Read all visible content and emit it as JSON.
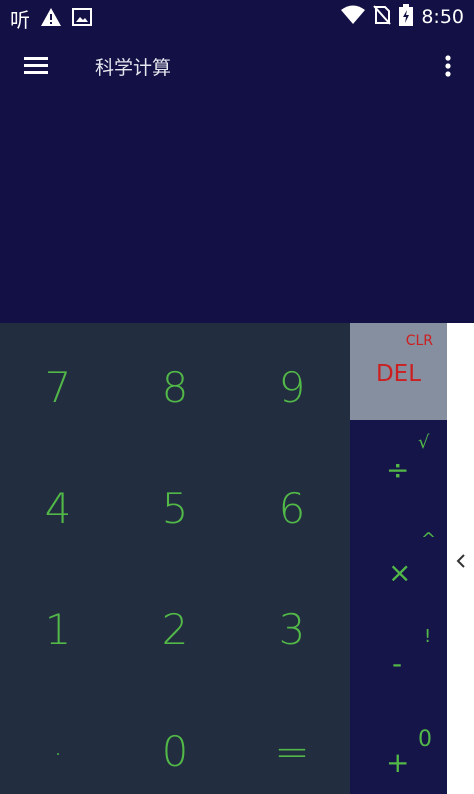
{
  "status_bar": {
    "app_glyph": "听",
    "time": "8:50",
    "icons": [
      "warning-icon",
      "image-icon",
      "wifi-icon",
      "no-sim-icon",
      "battery-charging-icon"
    ]
  },
  "app_bar": {
    "title": "科学计算",
    "menu_icon": "hamburger-menu-icon",
    "more_icon": "more-vert-icon"
  },
  "keypad": {
    "row1": [
      "7",
      "8",
      "9"
    ],
    "row2": [
      "4",
      "5",
      "6"
    ],
    "row3": [
      "1",
      "2",
      "3"
    ],
    "row4": [
      ".",
      "0",
      "="
    ]
  },
  "ops": {
    "clr": "CLR",
    "del": "DEL",
    "divide": "÷",
    "sqrt": "√",
    "multiply": "×",
    "power": "^",
    "minus": "-",
    "factorial": "!",
    "plus": "+",
    "zero_sup": "0"
  },
  "side_panel": {
    "icon": "chevron-left-icon"
  },
  "colors": {
    "background": "#121044",
    "keypad_bg": "#222d3f",
    "key_text": "#52b848",
    "del_bg": "#858fa0",
    "del_text": "#cc1f1f"
  }
}
